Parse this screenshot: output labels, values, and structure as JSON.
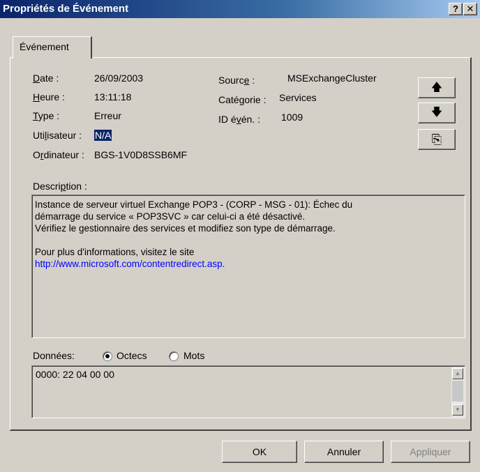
{
  "window": {
    "title": "Propriétés de Événement",
    "help_glyph": "?",
    "close_glyph": "✕"
  },
  "tabs": [
    {
      "label": "Événement"
    }
  ],
  "fields": {
    "date": {
      "label_pre": "",
      "label_acc": "D",
      "label_post": "ate :",
      "value": "26/09/2003"
    },
    "heure": {
      "label_pre": "",
      "label_acc": "H",
      "label_post": "eure :",
      "value": "13:11:18"
    },
    "type": {
      "label_pre": "",
      "label_acc": "T",
      "label_post": "ype :",
      "value": "Erreur"
    },
    "utilisateur": {
      "label_pre": "Uti",
      "label_acc": "l",
      "label_post": "isateur :",
      "value": "N/A"
    },
    "ordinateur": {
      "label_pre": "O",
      "label_acc": "r",
      "label_post": "dinateur :",
      "value": "BGS-1V0D8SSB6MF"
    },
    "source": {
      "label_pre": "Sourc",
      "label_acc": "e",
      "label_post": " :",
      "value": "MSExchangeCluster"
    },
    "categorie": {
      "label_pre": "Caté",
      "label_acc": "g",
      "label_post": "orie :",
      "value": "Services"
    },
    "id": {
      "label_pre": "ID é",
      "label_acc": "v",
      "label_post": "én. :",
      "value": "1009"
    }
  },
  "nav_buttons": {
    "up_glyph": "🡅",
    "down_glyph": "🡇",
    "copy_glyph": "⎘"
  },
  "description": {
    "label_pre": "Descri",
    "label_acc": "p",
    "label_post": "tion :",
    "line1": "Instance de serveur virtuel Exchange POP3 - (CORP - MSG - 01): Échec du",
    "line2": "démarrage du service « POP3SVC » car celui-ci a été désactivé.",
    "line3": "Vérifiez le gestionnaire des services et modifiez son type de démarrage.",
    "line4": "Pour plus d'informations, visitez le site",
    "link": "http://www.microsoft.com/contentredirect.asp",
    "link_tail": "."
  },
  "donnees": {
    "label": "Données:",
    "option_octets": "Octecs",
    "option_mots": "Mots",
    "selected": "Octecs",
    "content": "0000: 22 04 00 00",
    "scroll_up": "▲",
    "scroll_down": "▼"
  },
  "footer": {
    "ok": "OK",
    "annuler": "Annuler",
    "appliquer": "Appliquer"
  }
}
